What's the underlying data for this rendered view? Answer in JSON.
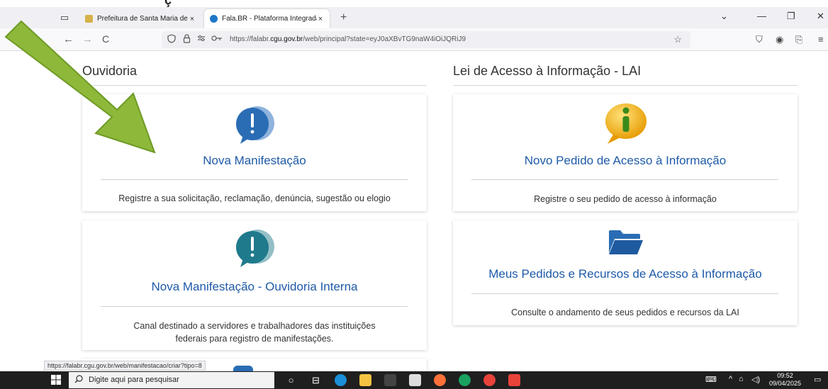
{
  "heading_clipped": "ç",
  "browser": {
    "tabs": [
      {
        "label": "Prefeitura de Santa Maria de Je",
        "close": "×"
      },
      {
        "label": "Fala.BR - Plataforma Integrada d",
        "close": "×"
      }
    ],
    "new_tab": "+",
    "tab_list_icon": "▭",
    "window_controls": {
      "dropdown": "⌄",
      "minimize": "—",
      "restore": "❐",
      "close": "✕"
    },
    "nav": {
      "back": "←",
      "forward": "→",
      "reload": "C"
    },
    "url": {
      "prefix": "https://falabr.",
      "host": "cgu.gov.br",
      "path": "/web/principal?state=eyJ0aXBvTG9naW4iOiJQRiJ9"
    },
    "star": "☆",
    "right_icons": {
      "pocket": "⛉",
      "account": "◉",
      "extensions": "⎘",
      "menu": "≡"
    }
  },
  "page": {
    "ouvidoria_title": "Ouvidoria",
    "lai_title": "Lei de Acesso à Informação - LAI",
    "cards": {
      "nova_manifestacao": {
        "title": "Nova Manifestação",
        "desc": "Registre a sua solicitação, reclamação, denúncia, sugestão ou elogio"
      },
      "ouvidoria_interna": {
        "title": "Nova Manifestação - Ouvidoria Interna",
        "desc_line1": "Canal destinado a servidores e trabalhadores das instituições",
        "desc_line2": "federais para registro de manifestações."
      },
      "novo_pedido": {
        "title": "Novo Pedido de Acesso à Informação",
        "desc": "Registre o seu pedido de acesso à informação"
      },
      "meus_pedidos": {
        "title": "Meus Pedidos e Recursos de Acesso à Informação",
        "desc": "Consulte o andamento de seus pedidos e recursos da LAI"
      }
    },
    "status_link": "https://falabr.cgu.gov.br/web/manifestacao/criar?tipo=8"
  },
  "taskbar": {
    "search_placeholder": "Digite aqui para pesquisar",
    "time": "09:52",
    "date": "09/04/2025"
  },
  "colors": {
    "link_blue": "#1e5aa8",
    "arrow_green": "#8db83a",
    "icon_blue": "#2a6db5",
    "icon_teal": "#1f7a8c",
    "info_yellow": "#f2b705"
  }
}
